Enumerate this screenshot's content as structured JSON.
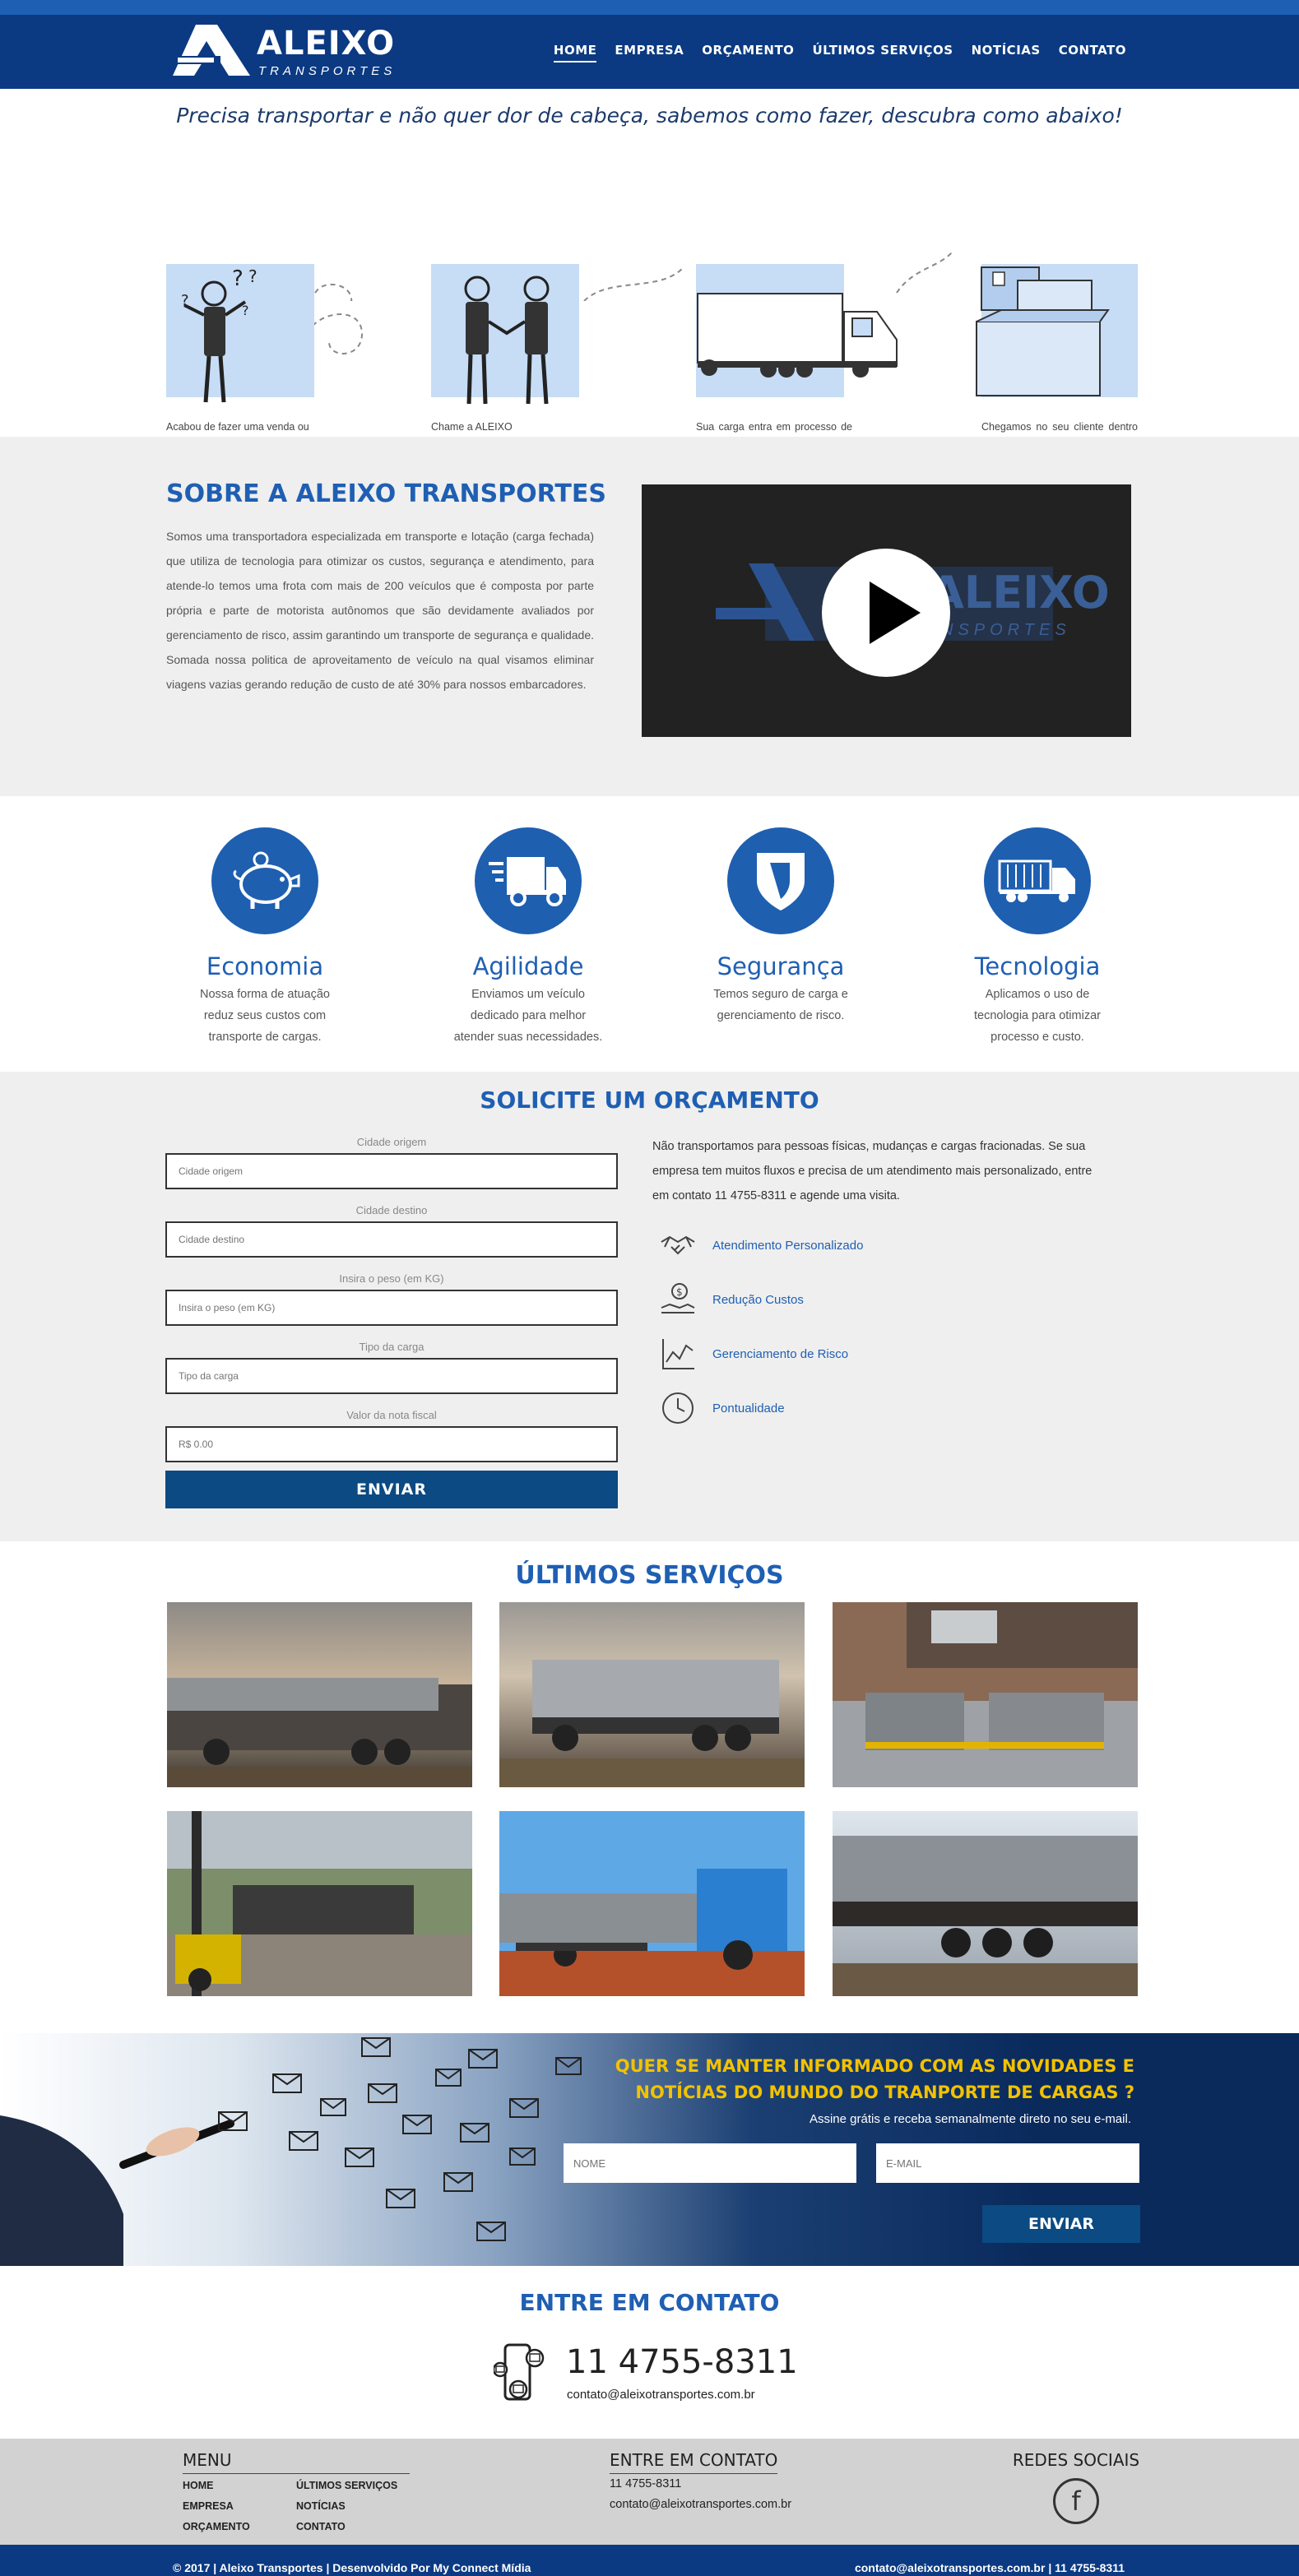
{
  "colors": {
    "brand_blue": "#0b3a82",
    "accent_blue": "#1f5fb3",
    "button_blue": "#0b4a83",
    "news_yellow": "#f2c200",
    "section_gray": "#efefef",
    "footer_gray": "#d2d2d2"
  },
  "header": {
    "logo_word": "ALEIXO",
    "logo_sub": "TRANSPORTES",
    "nav": [
      "HOME",
      "EMPRESA",
      "ORÇAMENTO",
      "ÚLTIMOS SERVIÇOS",
      "NOTÍCIAS",
      "CONTATO"
    ]
  },
  "tagline": "Precisa transportar e não quer dor de cabeça, sabemos como fazer, descubra como abaixo!",
  "steps": [
    "Acabou de fazer uma venda ou concluir um projeto e precisa entregar no seu cliente, porém existe uma grande distância entre você e ele ?",
    "Chame a ALEIXO TRANSPORTES, após entender as necessidades da sua carga, enviamos um veículo dedicado a sua empresa para fazer a coleta.",
    "Sua carga entra em processo de viagem, mas para evitar dor de cabeça, saiba que contamos com seguro e gerenciamento de risco.",
    "Chegamos no seu cliente dentro do prazo combinado e com tudo em ordem. Assim acabando com a distância que existia."
  ],
  "about": {
    "title": "SOBRE A ALEIXO TRANSPORTES",
    "text": "Somos uma transportadora especializada em transporte e lotação (carga fechada) que utiliza de tecnologia para otimizar os custos, segurança e atendimento, para atende-lo temos uma frota com mais de 200 veículos que é composta por parte própria e parte de motorista autônomos que são devidamente avaliados por gerenciamento de risco, assim garantindo um transporte de segurança e qualidade. Somada nossa politica de aproveitamento de veículo na qual visamos eliminar viagens vazias gerando redução de custo de até 30% para nossos embarcadores.",
    "video_logo_word": "ALEIXO",
    "video_logo_sub": "TRANSPORTES"
  },
  "features": [
    {
      "icon": "piggy-bank-icon",
      "title": "Economia",
      "text": "Nossa forma de atuação reduz seus custos com transporte de cargas."
    },
    {
      "icon": "delivery-truck-icon",
      "title": "Agilidade",
      "text": "Enviamos um veículo dedicado para melhor atender suas necessidades."
    },
    {
      "icon": "shield-icon",
      "title": "Segurança",
      "text": "Temos seguro de carga e gerenciamento de risco."
    },
    {
      "icon": "container-truck-icon",
      "title": "Tecnologia",
      "text": "Aplicamos o uso de tecnologia para otimizar processo e custo."
    }
  ],
  "quote": {
    "title": "SOLICITE UM ORÇAMENTO",
    "fields": [
      {
        "label": "Cidade origem",
        "placeholder": "Cidade origem"
      },
      {
        "label": "Cidade destino",
        "placeholder": "Cidade destino"
      },
      {
        "label": "Insira o peso (em KG)",
        "placeholder": "Insira o peso (em KG)"
      },
      {
        "label": "Tipo da carga",
        "placeholder": "Tipo da carga"
      },
      {
        "label": "Valor da nota fiscal",
        "placeholder": "R$ 0.00"
      }
    ],
    "submit": "ENVIAR",
    "text": "Não transportamos para pessoas físicas, mudanças e cargas fracionadas. Se sua empresa tem muitos fluxos e precisa de um atendimento mais personalizado, entre em contato 11 4755-8311 e agende uma visita.",
    "benefits": [
      "Atendimento Personalizado",
      "Redução Custos",
      "Gerenciamento de Risco",
      "Pontualidade"
    ]
  },
  "services": {
    "title": "ÚLTIMOS SERVIÇOS"
  },
  "newsletter": {
    "title_line1": "QUER SE MANTER INFORMADO COM AS NOVIDADES E",
    "title_line2": "NOTÍCIAS  DO MUNDO DO TRANPORTE DE CARGAS ?",
    "subtitle": "Assine grátis e receba semanalmente direto no seu e-mail.",
    "name_placeholder": "NOME",
    "email_placeholder": "E-MAIL",
    "submit": "ENVIAR"
  },
  "contact": {
    "title": "ENTRE EM CONTATO",
    "phone": "11 4755-8311",
    "email": "contato@aleixotransportes.com.br"
  },
  "footer": {
    "menu_title": "MENU",
    "menu_col1": [
      "HOME",
      "EMPRESA",
      "ORÇAMENTO"
    ],
    "menu_col2": [
      "ÚLTIMOS SERVIÇOS",
      "NOTÍCIAS",
      "CONTATO"
    ],
    "contact_title": "ENTRE EM CONTATO",
    "contact_phone": "11 4755-8311",
    "contact_email": "contato@aleixotransportes.com.br",
    "social_title": "REDES SOCIAIS",
    "copyright": "© 2017 |   Aleixo Transportes | Desenvolvido Por My Connect Mídia",
    "bottom_right": "contato@aleixotransportes.com.br | 11 4755-8311"
  }
}
